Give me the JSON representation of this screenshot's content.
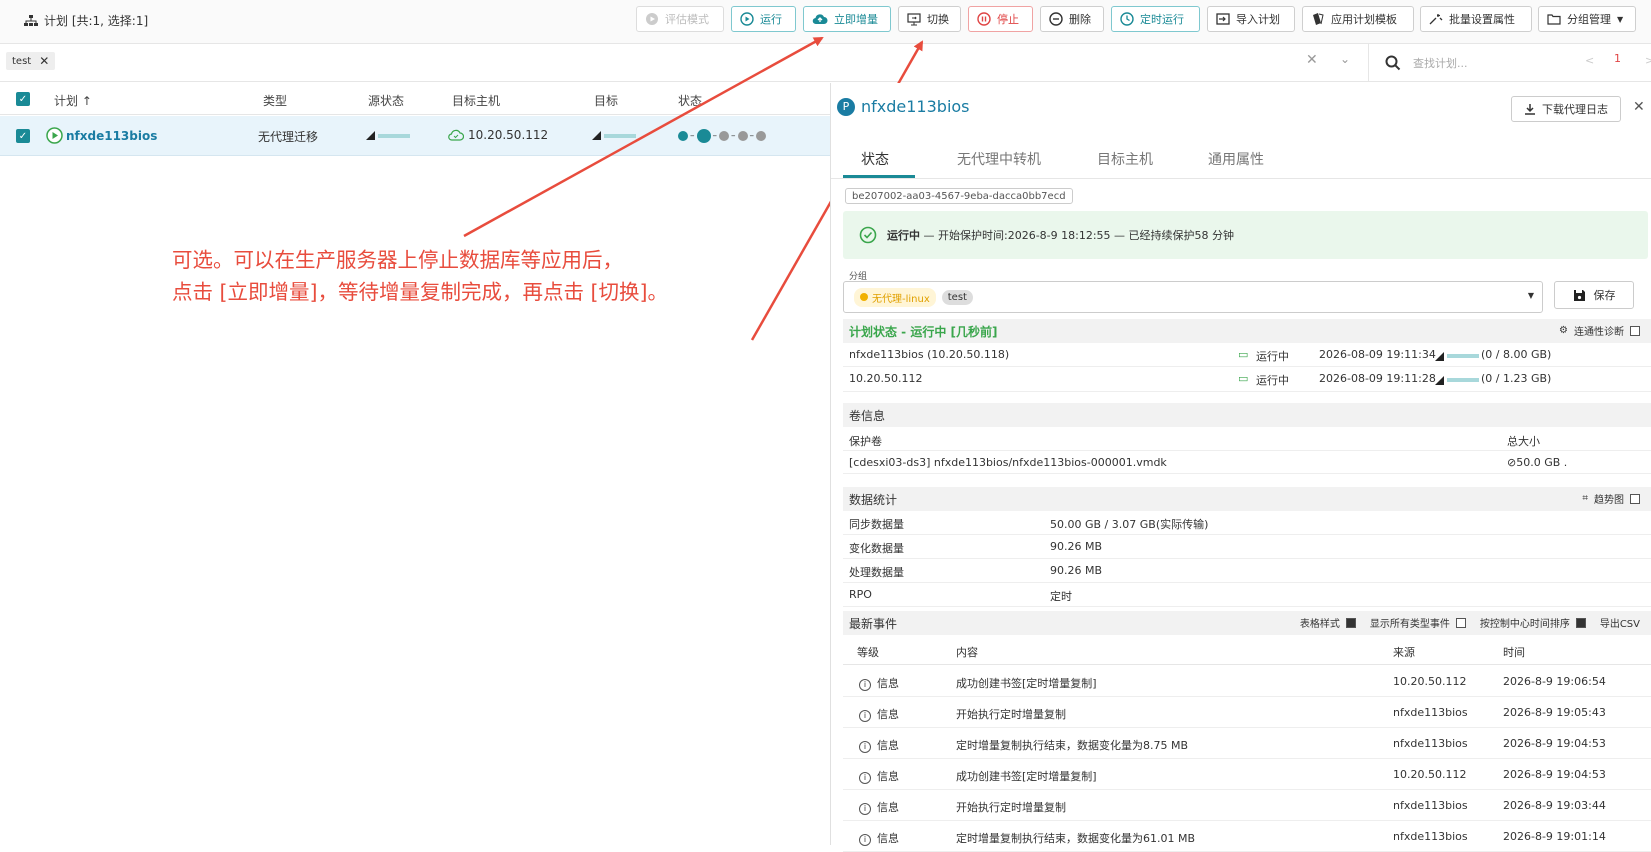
{
  "header": {
    "title": "计划 [共:1, 选择:1]",
    "buttons": {
      "eval_mode": "评估模式",
      "run": "运行",
      "incremental": "立即增量",
      "switch": "切换",
      "stop": "停止",
      "delete": "删除",
      "schedule_run": "定时运行",
      "import_plan": "导入计划",
      "app_template": "应用计划模板",
      "batch_props": "批量设置属性",
      "group_mgmt": "分组管理"
    }
  },
  "filter": {
    "chip": "test",
    "search_placeholder": "查找计划...",
    "page": "1"
  },
  "list": {
    "columns": [
      "计划",
      "类型",
      "源状态",
      "目标主机",
      "目标",
      "状态"
    ],
    "sort_arrow": "↑",
    "row": {
      "name": "nfxde113bios",
      "type": "无代理迁移",
      "target_host": "10.20.50.112"
    }
  },
  "annotation": {
    "line1": "可选。可以在生产服务器上停止数据库等应用后，",
    "line2": "点击 [立即增量]，等待增量复制完成，再点击 [切换]。"
  },
  "panel": {
    "badge": "P",
    "title": "nfxde113bios",
    "download_log": "下载代理日志",
    "tabs": [
      "状态",
      "无代理中转机",
      "目标主机",
      "通用属性"
    ],
    "uuid": "be207002-aa03-4567-9eba-dacca0bb7ecd",
    "status_bold": "运行中",
    "status_text": " — 开始保护时间:2026-8-9 18:12:55 — 已经持续保护58 分钟",
    "group_label": "分组",
    "group_tags": [
      "无代理-linux",
      "test"
    ],
    "save": "保存",
    "plan_status_title": "计划状态 - 运行中 [几秒前]",
    "connectivity": "连通性诊断",
    "plan_rows": [
      {
        "name": "nfxde113bios (10.20.50.118)",
        "state": "运行中",
        "time": "2026-08-09 19:11:34",
        "size": "(0 / 8.00 GB)"
      },
      {
        "name": "10.20.50.112",
        "state": "运行中",
        "time": "2026-08-09 19:11:28",
        "size": "(0 / 1.23 GB)"
      }
    ],
    "volume_title": "卷信息",
    "volume_cols": [
      "保护卷",
      "总大小"
    ],
    "volume_row": {
      "name": "[cdesxi03-ds3] nfxde113bios/nfxde113bios-000001.vmdk",
      "size": "⊘50.0 GB ."
    },
    "stats_title": "数据统计",
    "trend": "趋势图",
    "stats": [
      {
        "k": "同步数据量",
        "v": "50.00 GB / 3.07 GB(实际传输)"
      },
      {
        "k": "变化数据量",
        "v": "90.26 MB"
      },
      {
        "k": "处理数据量",
        "v": "90.26 MB"
      },
      {
        "k": "RPO",
        "v": "定时"
      }
    ],
    "events_title": "最新事件",
    "event_opts": [
      "表格样式",
      "显示所有类型事件",
      "按控制中心时间排序",
      "导出CSV"
    ],
    "event_cols": [
      "等级",
      "内容",
      "来源",
      "时间"
    ],
    "events": [
      {
        "level": "信息",
        "content": "成功创建书签[定时增量复制]",
        "source": "10.20.50.112",
        "time": "2026-8-9 19:06:54"
      },
      {
        "level": "信息",
        "content": "开始执行定时增量复制",
        "source": "nfxde113bios",
        "time": "2026-8-9 19:05:43"
      },
      {
        "level": "信息",
        "content": "定时增量复制执行结束，数据变化量为8.75 MB",
        "source": "nfxde113bios",
        "time": "2026-8-9 19:04:53"
      },
      {
        "level": "信息",
        "content": "成功创建书签[定时增量复制]",
        "source": "10.20.50.112",
        "time": "2026-8-9 19:04:53"
      },
      {
        "level": "信息",
        "content": "开始执行定时增量复制",
        "source": "nfxde113bios",
        "time": "2026-8-9 19:03:44"
      },
      {
        "level": "信息",
        "content": "定时增量复制执行结束，数据变化量为61.01 MB",
        "source": "nfxde113bios",
        "time": "2026-8-9 19:01:14"
      }
    ]
  }
}
